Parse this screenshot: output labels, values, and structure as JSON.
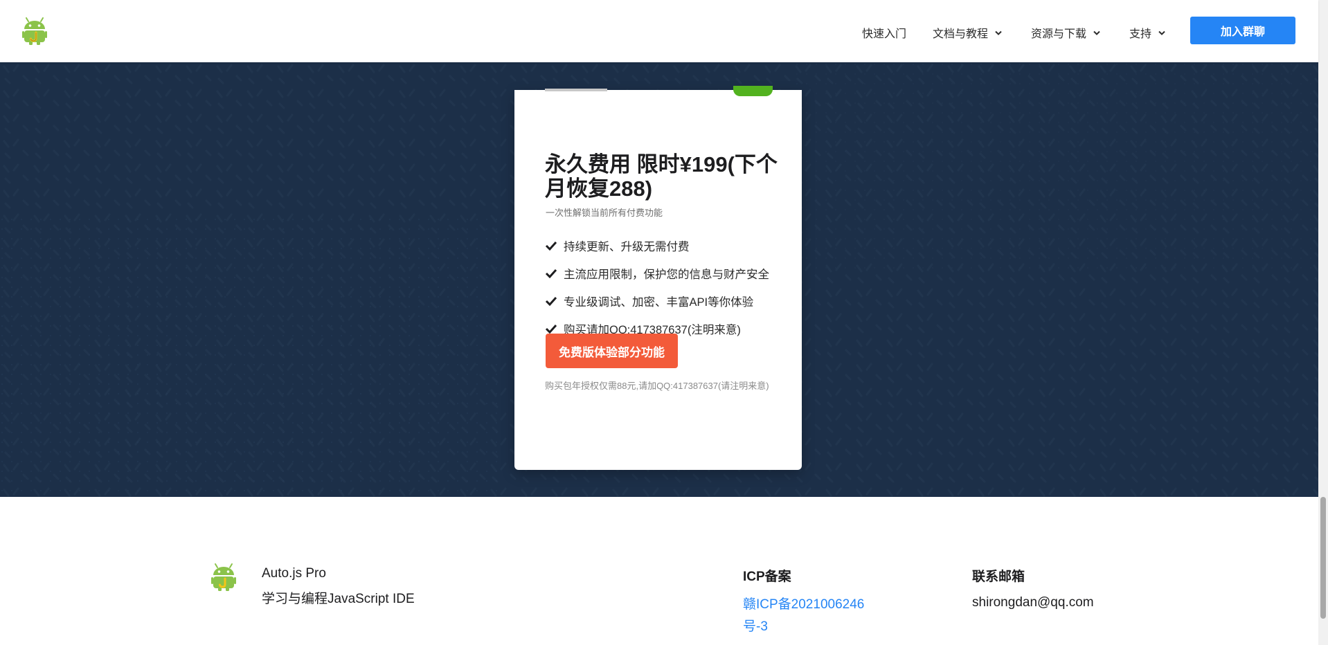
{
  "navbar": {
    "logo_icon": "android-robot-j-logo",
    "items": [
      {
        "label": "快速入门",
        "has_dropdown": false
      },
      {
        "label": "文档与教程",
        "has_dropdown": true
      },
      {
        "label": "资源与下载",
        "has_dropdown": true
      },
      {
        "label": "支持",
        "has_dropdown": true
      }
    ],
    "join_button": "加入群聊"
  },
  "pricing_card": {
    "title": "永久费用 限时¥199(下个月恢复288)",
    "subtitle": "一次性解锁当前所有付费功能",
    "features": [
      "持续更新、升级无需付费",
      "主流应用限制，保护您的信息与财产安全",
      "专业级调试、加密、丰富API等你体验",
      "购买请加QQ:417387637(注明来意)"
    ],
    "free_button": "免费版体验部分功能",
    "note": "购买包年授权仅需88元,请加QQ:417387637(请注明来意)"
  },
  "footer": {
    "brand": "Auto.js Pro",
    "tagline": "学习与编程JavaScript IDE",
    "icp_heading": "ICP备案",
    "icp_link": "赣ICP备2021006246号-3",
    "email_heading": "联系邮箱",
    "email": "shirongdan@qq.com"
  },
  "colors": {
    "primary": "#2585f5",
    "cta": "#f35b3a",
    "dark_bg": "#1c2f48",
    "badge": "#52b21f",
    "logo_green": "#8bc34a"
  }
}
